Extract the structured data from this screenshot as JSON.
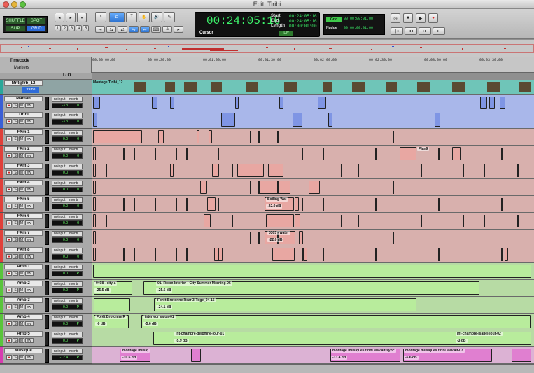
{
  "window": {
    "title": "Edit: Tiribi"
  },
  "toolbar": {
    "modes": [
      "SHUFFLE",
      "SPOT",
      "SLIP",
      "GRID"
    ],
    "number_keys": [
      "1",
      "2",
      "3",
      "4",
      "5"
    ],
    "counter": {
      "main": "00:24:05:16",
      "start_label": "Start",
      "start": "00:24:05:16",
      "end_label": "End",
      "end": "00:24:05:16",
      "length_label": "Length",
      "length": "00:00:00:00",
      "cursor_label": "Cursor",
      "dly_label": "Dly"
    },
    "grid": {
      "label": "Grid",
      "value": "00:00:00:01.00"
    },
    "nudge": {
      "label": "Nudge",
      "value": "00:00:00:01.00"
    }
  },
  "ruler": {
    "label": "Timecode",
    "markers_label": "Markers",
    "io_label": "I / O",
    "ticks": [
      "00:00:00:00",
      "00:00:30:00",
      "00:01:00:00",
      "00:01:30:00",
      "00:02:00:00",
      "00:02:30:00",
      "00:03:00:00",
      "00:03:30:00"
    ]
  },
  "video_track": {
    "name": "MntgTrb_12",
    "mode": "frame",
    "clip_label": "Montage Tiribi_12"
  },
  "tracks": [
    {
      "name": "Maman",
      "input": "noinput",
      "output": "montr",
      "vol": "-3.3",
      "pan": "0",
      "color": "#3a5fd6",
      "lane": "#a9b7ea",
      "clip": "#7f95e4"
    },
    {
      "name": "Tiribi",
      "input": "noinput",
      "output": "montr",
      "vol": "-3.3",
      "pan": "0",
      "color": "#3a5fd6",
      "lane": "#a9b7ea",
      "clip": "#7f95e4"
    },
    {
      "name": "FXm 1",
      "input": "noinput",
      "output": "montr",
      "vol": "0.0",
      "pan": "0",
      "color": "#e0403a",
      "lane": "#d8b0ad",
      "clip": "#e8a7a2"
    },
    {
      "name": "FXm 2",
      "input": "noinput",
      "output": "montr",
      "vol": "0.0",
      "pan": "0",
      "color": "#e0403a",
      "lane": "#d8b0ad",
      "clip": "#e8a7a2"
    },
    {
      "name": "FXm 3",
      "input": "noinput",
      "output": "montr",
      "vol": "0.0",
      "pan": "0",
      "color": "#e0403a",
      "lane": "#d8b0ad",
      "clip": "#e8a7a2"
    },
    {
      "name": "FXm 4",
      "input": "noinput",
      "output": "montr",
      "vol": "0.0",
      "pan": "0",
      "color": "#e0403a",
      "lane": "#d8b0ad",
      "clip": "#e8a7a2"
    },
    {
      "name": "FXm 5",
      "input": "noinput",
      "output": "montr",
      "vol": "0.0",
      "pan": "0",
      "color": "#e0403a",
      "lane": "#d8b0ad",
      "clip": "#e8a7a2"
    },
    {
      "name": "FXm 6",
      "input": "noinput",
      "output": "montr",
      "vol": "0.0",
      "pan": "0",
      "color": "#e0403a",
      "lane": "#d8b0ad",
      "clip": "#e8a7a2"
    },
    {
      "name": "FXm 7",
      "input": "noinput",
      "output": "montr",
      "vol": "0.0",
      "pan": "0",
      "color": "#e0403a",
      "lane": "#d8b0ad",
      "clip": "#e8a7a2"
    },
    {
      "name": "FXm 8",
      "input": "noinput",
      "output": "montr",
      "vol": "0.0",
      "pan": "0",
      "color": "#e0403a",
      "lane": "#d8b0ad",
      "clip": "#e8a7a2"
    },
    {
      "name": "Amb 1",
      "input": "noinput",
      "output": "montr",
      "vol": "0.0",
      "pan": "P",
      "color": "#5ac43c",
      "lane": "#b7dba4",
      "clip": "#b8ec9c"
    },
    {
      "name": "Amb 2",
      "input": "noinput",
      "output": "montr",
      "vol": "0.0",
      "pan": "P",
      "color": "#5ac43c",
      "lane": "#b7dba4",
      "clip": "#b8ec9c"
    },
    {
      "name": "Amb 3",
      "input": "noinput",
      "output": "montr",
      "vol": "0.0",
      "pan": "P",
      "color": "#5ac43c",
      "lane": "#b7dba4",
      "clip": "#b8ec9c"
    },
    {
      "name": "Amb 4",
      "input": "noinput",
      "output": "montr",
      "vol": "0.0",
      "pan": "P",
      "color": "#5ac43c",
      "lane": "#b7dba4",
      "clip": "#b8ec9c"
    },
    {
      "name": "Amb 5",
      "input": "noinput",
      "output": "montr",
      "vol": "0.0",
      "pan": "P",
      "color": "#5ac43c",
      "lane": "#b7dba4",
      "clip": "#b8ec9c"
    },
    {
      "name": "Musique",
      "input": "noinput",
      "output": "montr",
      "vol": "-12.4",
      "pan": "P",
      "color": "#d83cb0",
      "lane": "#dcb2d4",
      "clip": "#e07fd0"
    }
  ],
  "clip_labels": {
    "fxm4": "Boiling Wat",
    "fxm5_vol": "-22.0 dB",
    "fxm7": "0305 - water",
    "fxm7_vol": "-22.0 dB",
    "plan": "Plan9",
    "amb2a": "0408 - city a",
    "amb2a_vol": "-25.5 dB",
    "amb2b": "01. Room Interior - City Summer Morning-05",
    "amb2b_vol": "-25.5 dB",
    "amb3": "Forêt Brotonne Rear 3-Toge_04-16",
    "amb3_vol": "-24.1 dB",
    "amb4a": "Forêt Brotonne R",
    "amb4a_vol": "-0 dB",
    "amb4b": "interieur salon-01",
    "amb4b_vol": "-5.6 dB",
    "amb5a": "int-chambre-delphine-jour-01",
    "amb5a_vol": "-5.9 dB",
    "amb5b": "int-chambre-isabel-jour-02",
    "amb5b_vol": "-3 dB",
    "mus1": "montage musiq",
    "mus1_vol": "-10.6 dB",
    "mus2": "montage musiques tiribi wav.aif-sync",
    "mus2_vol": "-13.4 dB",
    "mus3": "montage musiques tiribi.wav.aif-03",
    "mus3_vol": "-6.6 dB"
  }
}
